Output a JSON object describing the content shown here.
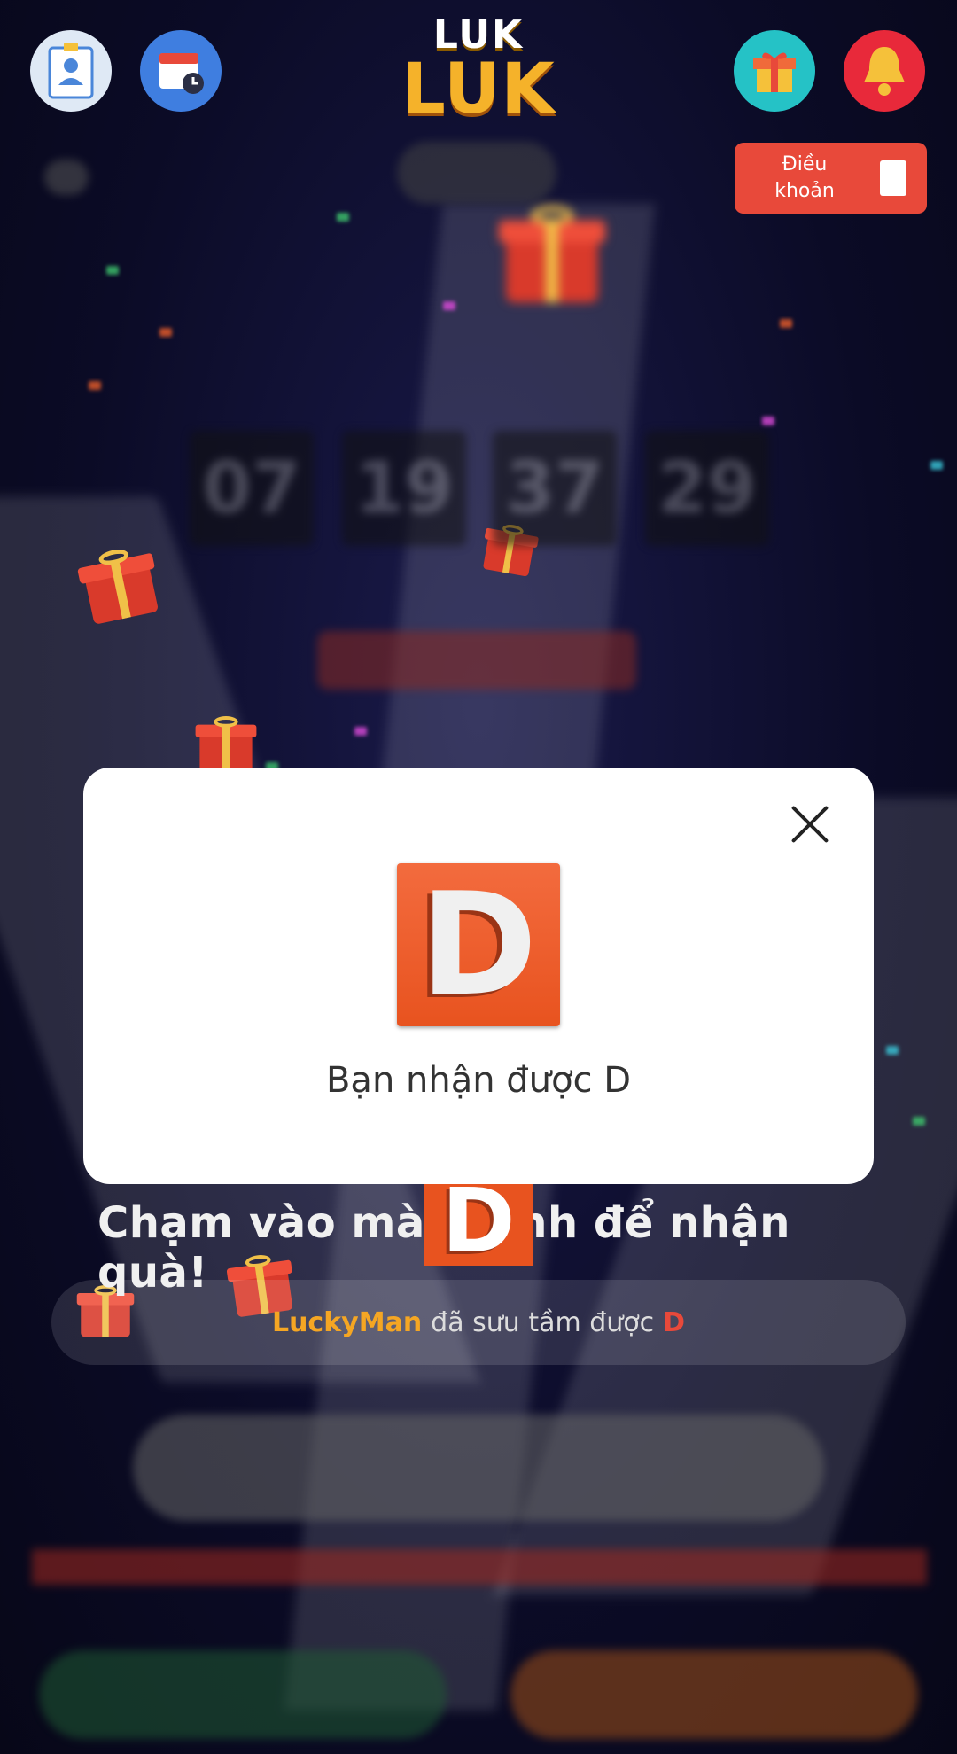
{
  "header": {
    "logo_top": "LUK",
    "logo_bottom": "LUK",
    "profile_icon": "profile-card-icon",
    "calendar_icon": "calendar-clock-icon",
    "gift_icon": "gift-icon",
    "bell_icon": "bell-icon",
    "terms_label_line1": "Điều",
    "terms_label_line2": "khoản"
  },
  "countdown": {
    "values": [
      "07",
      "19",
      "37",
      "29"
    ]
  },
  "modal": {
    "letter": "D",
    "message": "Bạn nhận được D",
    "close_icon": "close-icon"
  },
  "main": {
    "tap_text": "Chạm vào màn hình để nhận quà!",
    "tap_letter": "D",
    "ticker_user": "LuckyMan",
    "ticker_text": "đã sưu tầm được",
    "ticker_letter": "D"
  },
  "colors": {
    "background": "#0d0d2e",
    "accent_red": "#e8493a",
    "tile_orange": "#e8531f",
    "logo_gold": "#f5b22a",
    "ticker_user": "#f5a623"
  }
}
